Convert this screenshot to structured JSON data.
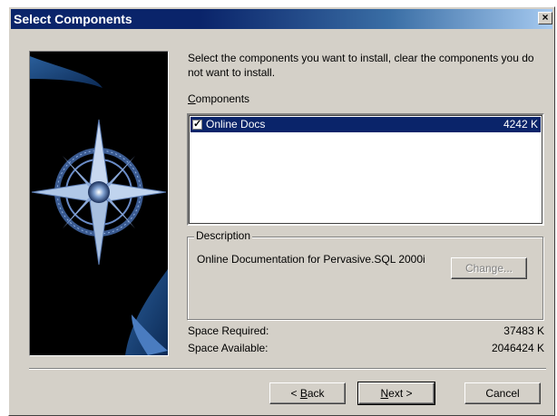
{
  "window": {
    "title": "Select Components",
    "close_glyph": "×"
  },
  "intro": {
    "text": "Select the components you want to install, clear the components you do not want to install."
  },
  "components": {
    "label_first": "C",
    "label_rest": "omponents",
    "items": [
      {
        "checked": true,
        "name": "Online Docs",
        "size": "4242 K"
      }
    ]
  },
  "description": {
    "legend": "Description",
    "text": "Online Documentation for Pervasive.SQL 2000i",
    "change_button": "Change..."
  },
  "space": {
    "required_label": "Space Required:",
    "required_value": "37483 K",
    "available_label": "Space Available:",
    "available_value": "2046424 K"
  },
  "buttons": {
    "back_prefix": "< ",
    "back_hotkey": "B",
    "back_rest": "ack",
    "next_hotkey": "N",
    "next_rest": "ext >",
    "cancel": "Cancel"
  },
  "colors": {
    "title_bar": "#0a246a",
    "dialog_face": "#d4d0c8",
    "selection": "#0a246a"
  },
  "icons": {
    "checkbox": "check-icon",
    "close": "close-icon",
    "banner": "compass-star-graphic"
  }
}
